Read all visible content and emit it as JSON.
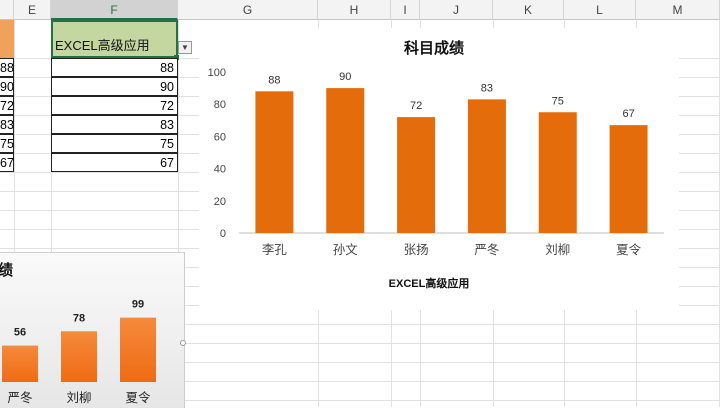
{
  "spreadsheet": {
    "column_headers": [
      "E",
      "F",
      "G",
      "H",
      "I",
      "J",
      "K",
      "L",
      "M"
    ],
    "selected_column": "F",
    "header_cell_F": "EXCEL高级应用",
    "filter_icon": "dropdown-arrow-icon",
    "column_F_values": [
      "88",
      "90",
      "72",
      "83",
      "75",
      "67"
    ],
    "column_D_partial_values": [
      "88",
      "90",
      "72",
      "83",
      "75",
      "67"
    ],
    "colors": {
      "selection": "#217346",
      "header_fill": "#c5d7a0",
      "partial_fill": "#f0a25c"
    }
  },
  "chart_data": [
    {
      "type": "bar",
      "title": "科目成绩",
      "xlabel": "EXCEL高级应用",
      "ylabel": "",
      "categories": [
        "李孔",
        "孙文",
        "张扬",
        "严冬",
        "刘柳",
        "夏令"
      ],
      "values": [
        88,
        90,
        72,
        83,
        75,
        67
      ],
      "ylim": [
        0,
        100
      ],
      "yticks": [
        0,
        20,
        40,
        60,
        80,
        100
      ],
      "data_labels": true,
      "grid": false,
      "legend": "none",
      "bar_color": "#e46c0a"
    },
    {
      "type": "bar",
      "title": "绩",
      "categories": [
        "严冬",
        "刘柳",
        "夏令"
      ],
      "values": [
        56,
        78,
        99
      ],
      "data_labels": true,
      "legend": "none",
      "bar_color": "#f07c2c",
      "partially_visible": true
    }
  ]
}
